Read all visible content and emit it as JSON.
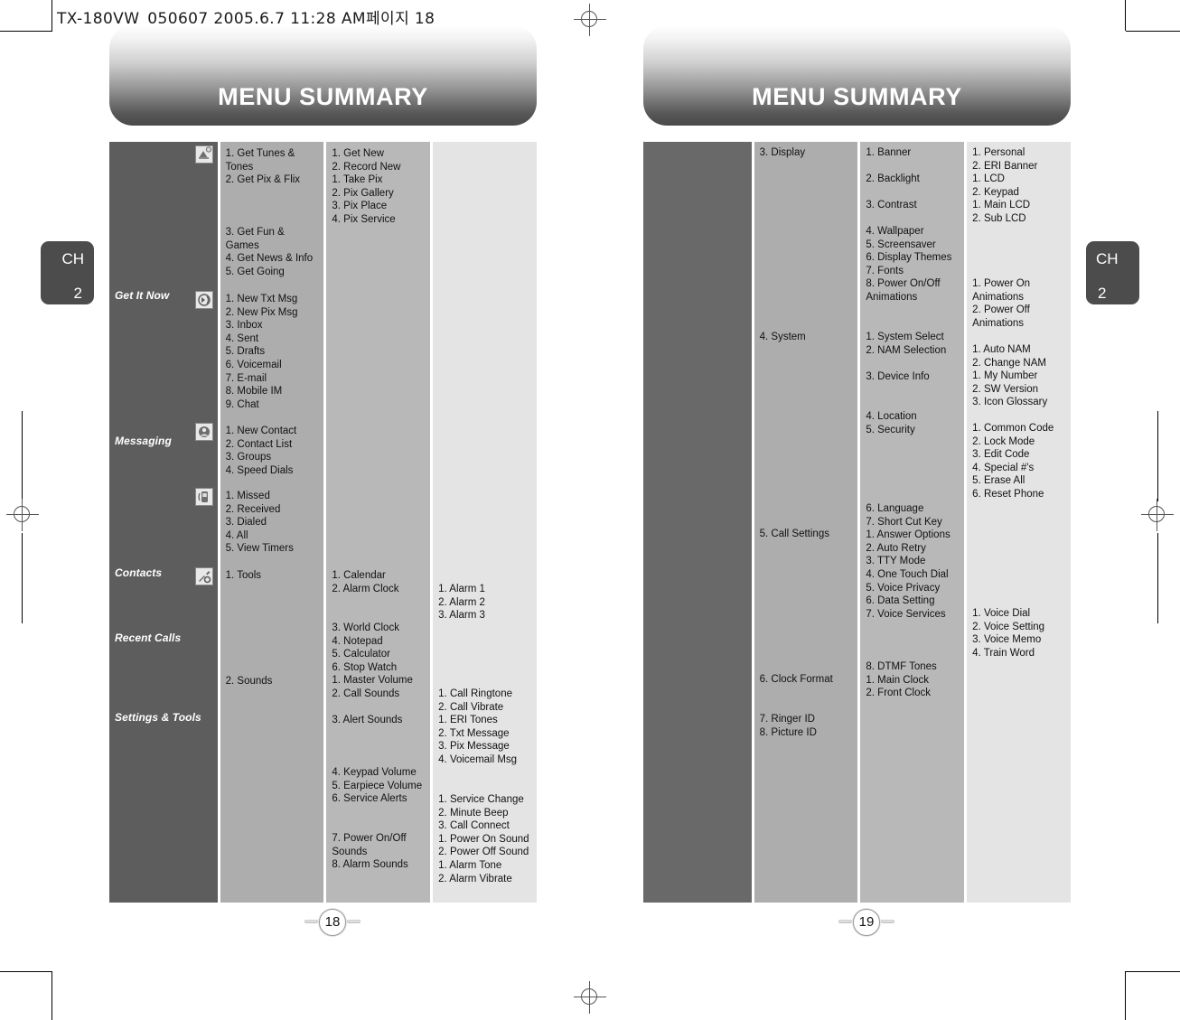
{
  "document": {
    "file_header": "TX-180VW_050607  2005.6.7 11:28 AM페이지 18",
    "banner_title_left": "MENU SUMMARY",
    "banner_title_right": "MENU SUMMARY",
    "chapter_label": "CH",
    "chapter_number": "2",
    "page_left": "18",
    "page_right": "19"
  },
  "left_page": {
    "categories": [
      {
        "label": "Get It Now",
        "icon": "get-it-now-icon"
      },
      {
        "label": "Messaging",
        "icon": "messaging-icon"
      },
      {
        "label": "Contacts",
        "icon": "contacts-icon"
      },
      {
        "label": "Recent Calls",
        "icon": "recent-calls-icon"
      },
      {
        "label": "Settings & Tools",
        "icon": "settings-tools-icon"
      }
    ],
    "level1": [
      "1. Get Tunes &\n    Tones\n2. Get Pix & Flix",
      "3. Get Fun &\n    Games\n4. Get News & Info\n5. Get Going",
      "1. New Txt Msg\n2. New Pix Msg\n3. Inbox\n4. Sent\n5. Drafts\n6. Voicemail\n7. E-mail\n8. Mobile IM\n9. Chat",
      "1. New Contact\n2. Contact List\n3. Groups\n4. Speed Dials",
      "1. Missed\n2. Received\n3. Dialed\n4. All\n5. View Timers",
      "1. Tools",
      "2. Sounds"
    ],
    "level2": [
      "1. Get New\n2. Record New\n1. Take Pix\n2. Pix Gallery\n3. Pix Place\n4. Pix Service",
      "1. Calendar\n2. Alarm Clock",
      "3. World Clock\n4. Notepad\n5. Calculator\n6. Stop Watch\n1. Master Volume\n2. Call Sounds",
      "3. Alert Sounds",
      "4. Keypad Volume\n5. Earpiece Volume\n6. Service Alerts",
      "7. Power On/Off\n    Sounds\n8. Alarm Sounds"
    ],
    "level3": [
      "1. Alarm 1\n2. Alarm 2\n3. Alarm 3",
      "1. Call Ringtone\n2. Call Vibrate\n1. ERI Tones\n2. Txt Message\n3. Pix Message\n4. Voicemail Msg",
      "1. Service Change\n2. Minute Beep\n3. Call Connect\n1. Power On Sound\n2. Power Off Sound\n1. Alarm Tone\n2. Alarm Vibrate"
    ]
  },
  "right_page": {
    "level1": [
      "3. Display",
      "4. System",
      "5. Call Settings",
      "6. Clock Format",
      "7. Ringer ID\n8. Picture ID"
    ],
    "level2": [
      "1. Banner",
      "2. Backlight",
      "3. Contrast",
      "4. Wallpaper\n5. Screensaver\n6. Display Themes\n7. Fonts\n8. Power On/Off\n    Animations",
      "1. System Select\n2. NAM Selection",
      "3. Device Info",
      "4. Location\n5. Security",
      "6. Language\n7. Short Cut Key\n1. Answer Options\n2. Auto Retry\n3. TTY Mode\n4. One Touch Dial\n5. Voice Privacy\n6. Data Setting\n7. Voice Services",
      "8. DTMF Tones\n1. Main Clock\n2. Front Clock"
    ],
    "level3": [
      "1. Personal\n2. ERI Banner\n1. LCD\n2. Keypad\n1. Main LCD\n2. Sub LCD",
      "1. Power On\n    Animations\n2. Power Off\n    Animations",
      "1. Auto NAM\n2. Change NAM\n1. My Number\n2. SW Version\n3. Icon Glossary",
      "1. Common Code\n2. Lock Mode\n3. Edit Code\n4. Special #'s\n5. Erase All\n6. Reset Phone",
      "1. Voice Dial\n2. Voice Setting\n3. Voice Memo\n4. Train Word"
    ]
  },
  "colors": {
    "category_column": "#5d5d5d",
    "level1_column": "#adadad",
    "level2_column": "#b8b8b8",
    "level3_column": "#e4e4e4",
    "banner_dark": "#4a4a4a",
    "chapter_tab": "#4c4c4c"
  }
}
